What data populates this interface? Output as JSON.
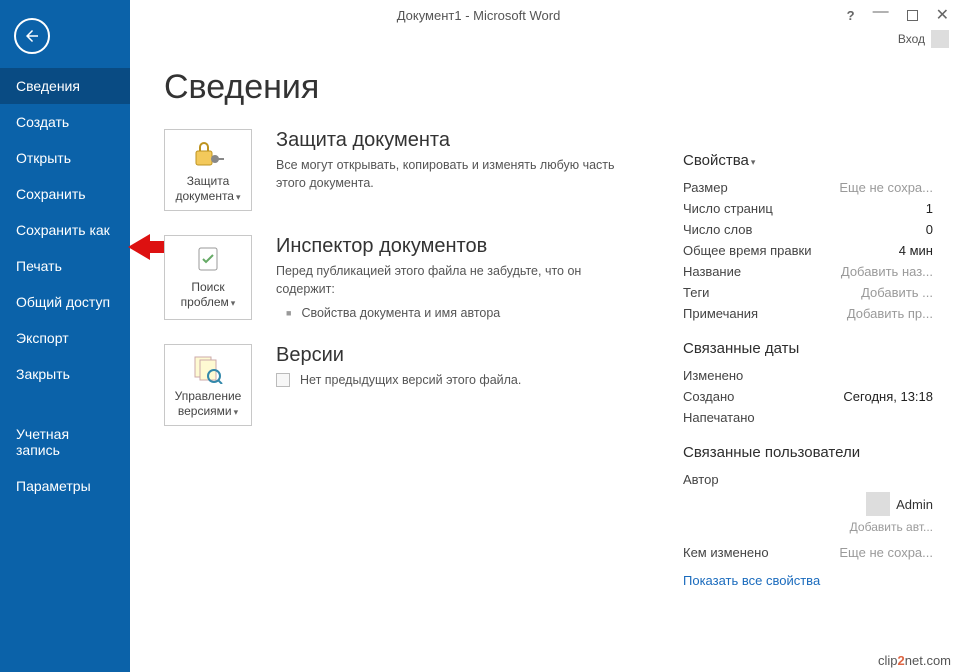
{
  "title": "Документ1 - Microsoft Word",
  "signin_label": "Вход",
  "sidebar": {
    "items": [
      "Сведения",
      "Создать",
      "Открыть",
      "Сохранить",
      "Сохранить как",
      "Печать",
      "Общий доступ",
      "Экспорт",
      "Закрыть"
    ],
    "items2": [
      "Учетная запись",
      "Параметры"
    ],
    "active_index": 0
  },
  "page_heading": "Сведения",
  "sections": {
    "protect": {
      "btn_label": "Защита документа",
      "title": "Защита документа",
      "desc": "Все могут открывать, копировать и изменять любую часть этого документа."
    },
    "inspect": {
      "btn_label": "Поиск проблем",
      "title": "Инспектор документов",
      "desc": "Перед публикацией этого файла не забудьте, что он содержит:",
      "items": [
        "Свойства документа и имя автора"
      ]
    },
    "versions": {
      "btn_label": "Управление версиями",
      "title": "Версии",
      "desc": "Нет предыдущих версий этого файла."
    }
  },
  "properties": {
    "heading": "Свойства",
    "rows": [
      {
        "k": "Размер",
        "v": "Еще не сохра...",
        "grey": true
      },
      {
        "k": "Число страниц",
        "v": "1"
      },
      {
        "k": "Число слов",
        "v": "0"
      },
      {
        "k": "Общее время правки",
        "v": "4 мин"
      },
      {
        "k": "Название",
        "v": "Добавить наз...",
        "grey": true
      },
      {
        "k": "Теги",
        "v": "Добавить ...",
        "grey": true
      },
      {
        "k": "Примечания",
        "v": "Добавить пр...",
        "grey": true
      }
    ],
    "dates_heading": "Связанные даты",
    "dates": [
      {
        "k": "Изменено",
        "v": ""
      },
      {
        "k": "Создано",
        "v": "Сегодня, 13:18"
      },
      {
        "k": "Напечатано",
        "v": ""
      }
    ],
    "people_heading": "Связанные пользователи",
    "author_label": "Автор",
    "author_name": "Admin",
    "add_author": "Добавить авт...",
    "changed_by_label": "Кем изменено",
    "changed_by_value": "Еще не сохра...",
    "show_all": "Показать все свойства"
  },
  "watermark": {
    "pre": "clip",
    "mid": "2",
    "post": "net",
    "tld": ".com"
  }
}
